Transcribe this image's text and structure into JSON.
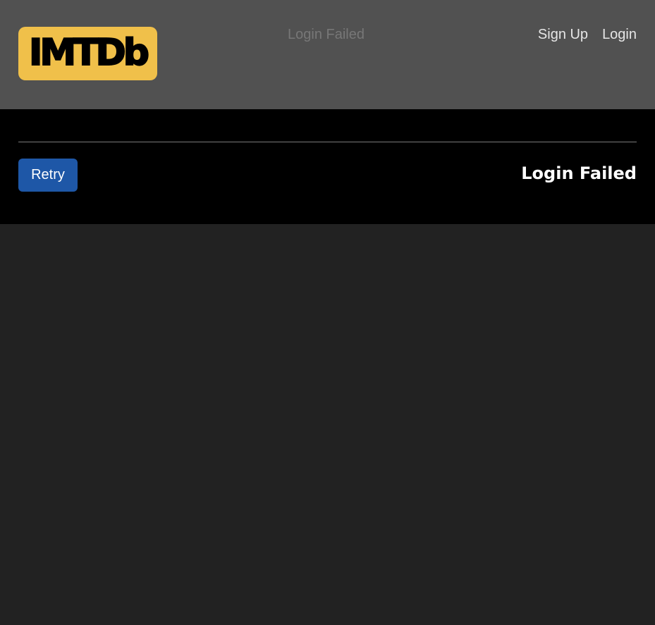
{
  "header": {
    "logo_text": "IMTDb",
    "status_text": "Login Failed",
    "nav": {
      "signup_label": "Sign Up",
      "login_label": "Login"
    }
  },
  "panel": {
    "retry_label": "Retry",
    "title": "Login Failed"
  },
  "colors": {
    "header_bg": "#515151",
    "logo_bg": "#f0c04a",
    "panel_bg": "#000000",
    "page_bg": "#222222",
    "button_bg": "#1e57a7"
  }
}
